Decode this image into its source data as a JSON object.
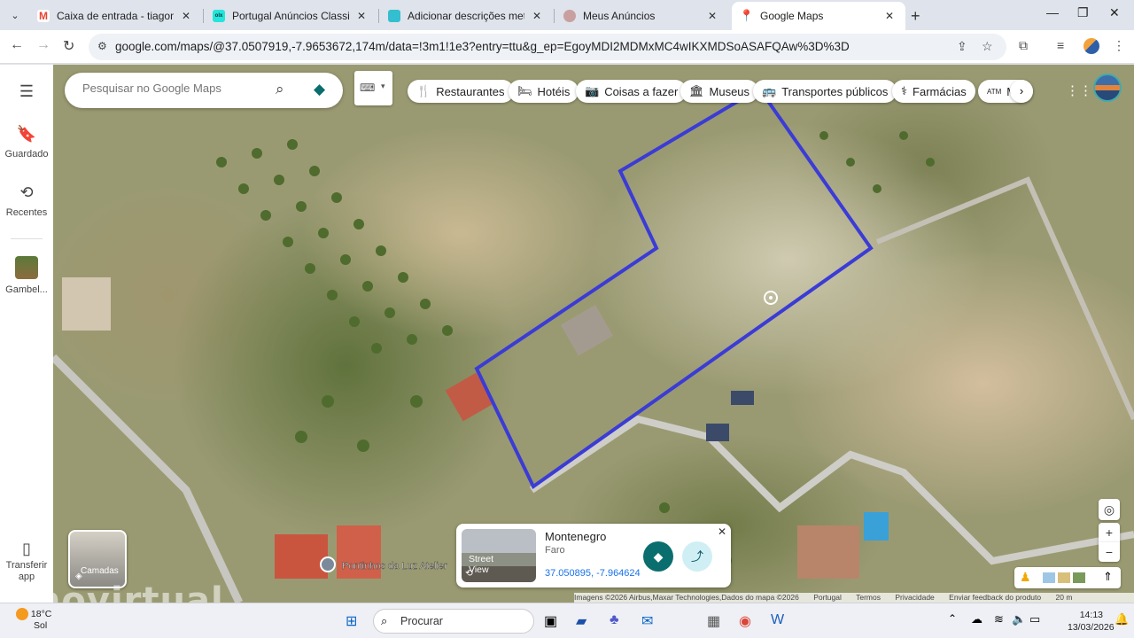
{
  "browser": {
    "tabs": [
      {
        "title": "Caixa de entrada - tiagomjv@gm",
        "icon": "gmail-icon",
        "color": "#ea4335",
        "glyph": "M"
      },
      {
        "title": "Portugal Anúncios Classificados",
        "icon": "olx-icon",
        "color": "#23e5db",
        "glyph": "olx"
      },
      {
        "title": "Adicionar descrições meta | Imo",
        "icon": "imovirtual-icon",
        "color": "#33bfd0",
        "glyph": ""
      },
      {
        "title": "Meus Anúncios",
        "icon": "meus-anuncios-icon",
        "color": "#c9a0a0",
        "glyph": ""
      },
      {
        "title": "Google Maps",
        "icon": "google-maps-icon",
        "color": "#34a853",
        "glyph": ""
      }
    ],
    "url": "google.com/maps/@37.0507919,-7.9653672,174m/data=!3m1!1e3?entry=ttu&g_ep=EgoyMDI2MDMxMC4wIKXMDSoASAFQAw%3D%3D"
  },
  "sidebar": {
    "saved": "Guardado",
    "recent": "Recentes",
    "place": "Gambel...",
    "transfer": "Transferir app"
  },
  "search": {
    "placeholder": "Pesquisar no Google Maps"
  },
  "chips": [
    {
      "label": "Restaurantes",
      "icon": "fork-knife-icon"
    },
    {
      "label": "Hotéis",
      "icon": "bed-icon"
    },
    {
      "label": "Coisas a fazer",
      "icon": "camera-icon"
    },
    {
      "label": "Museus",
      "icon": "museum-icon"
    },
    {
      "label": "Transportes públicos",
      "icon": "bus-icon"
    },
    {
      "label": "Farmácias",
      "icon": "pharmacy-icon"
    },
    {
      "label": "M",
      "icon": "atm-icon"
    }
  ],
  "map": {
    "layers_label": "Camadas",
    "poi_label": "Pontinhos da Luz Atelier",
    "scale": "20 m",
    "attribution": [
      "Imagens ©2026 Airbus,Maxar Technologies,Dados do mapa ©2026",
      "Portugal",
      "Termos",
      "Privacidade",
      "Enviar feedback do produto"
    ],
    "polygon_color": "#3b3bd6"
  },
  "place_card": {
    "name": "Montenegro",
    "region": "Faro",
    "coords": "37.050895, -7.964624",
    "street_view": "Street View"
  },
  "taskbar": {
    "temperature": "18°C",
    "weather": "Sol",
    "search": "Procurar",
    "time": "14:13",
    "date": "13/03/2026"
  },
  "watermark": "imovirtual"
}
